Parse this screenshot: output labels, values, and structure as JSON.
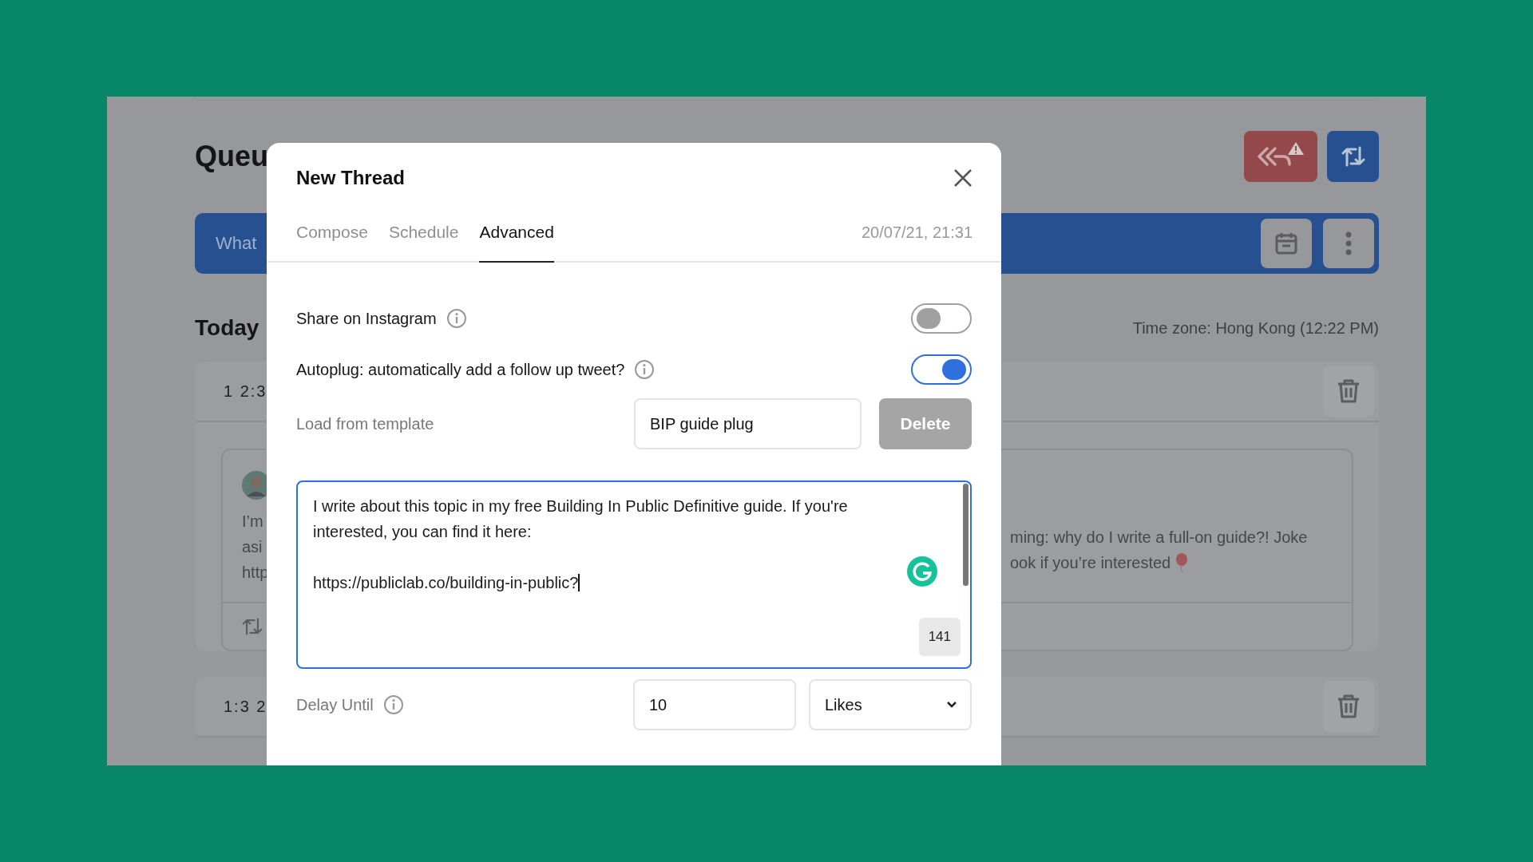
{
  "background": {
    "title": "Queu",
    "compose_text": "What",
    "section": "Today",
    "timezone": "Time zone: Hong Kong (12:22 PM)",
    "queue": [
      {
        "time": "1 2:3",
        "tweet_left": [
          "I’m",
          "asi",
          "http"
        ],
        "tweet_right": [
          "ming: why do I write a full-on guide?! Joke",
          "ook if you’re interested"
        ]
      },
      {
        "time": "1:3 2"
      }
    ]
  },
  "modal": {
    "title": "New Thread",
    "tabs": [
      {
        "label": "Compose",
        "selected": false
      },
      {
        "label": "Schedule",
        "selected": false
      },
      {
        "label": "Advanced",
        "selected": true
      }
    ],
    "timestamp": "20/07/21, 21:31",
    "toggles": [
      {
        "label": "Share on Instagram",
        "on": false
      },
      {
        "label": "Autoplug: automatically add a follow up tweet?",
        "on": true
      }
    ],
    "template": {
      "label": "Load from template",
      "value": "BIP guide plug",
      "button": "Delete"
    },
    "tweet_text": "I write about this topic in my free Building In Public Definitive guide. If you're interested, you can find it here:\n\nhttps://publiclab.co/building-in-public?",
    "char_count": "141",
    "delay": {
      "label": "Delay Until",
      "value": "10",
      "unit": "Likes"
    }
  }
}
